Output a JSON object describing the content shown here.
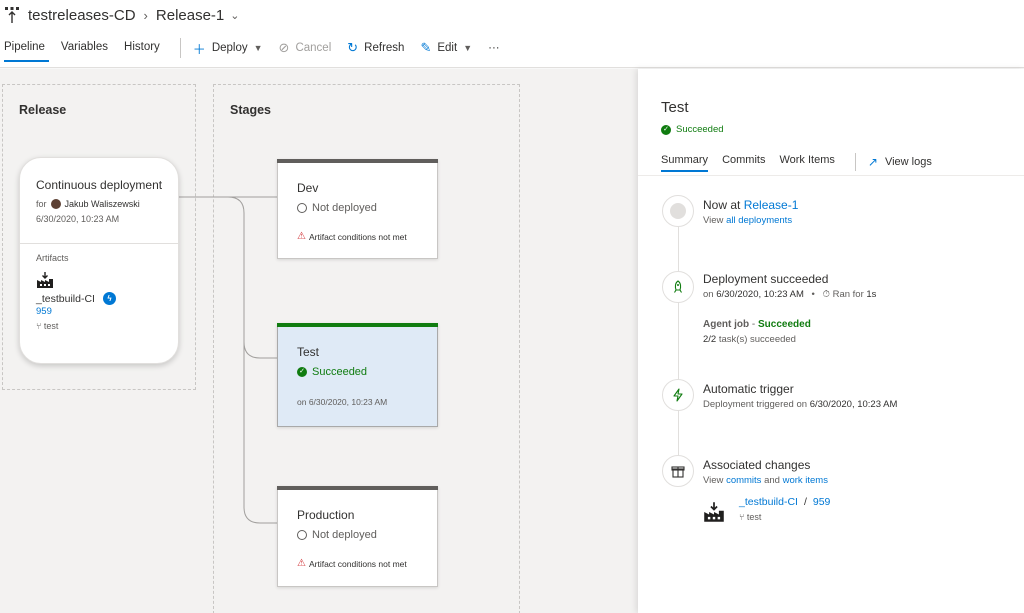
{
  "header": {
    "pipeline_name": "testreleases-CD",
    "release_name": "Release-1"
  },
  "toolbar": {
    "tabs": [
      {
        "label": "Pipeline",
        "active": true
      },
      {
        "label": "Variables",
        "active": false
      },
      {
        "label": "History",
        "active": false
      }
    ],
    "deploy_label": "Deploy",
    "cancel_label": "Cancel",
    "refresh_label": "Refresh",
    "edit_label": "Edit",
    "more_label": "···"
  },
  "canvas": {
    "release_group_title": "Release",
    "stages_group_title": "Stages",
    "trigger": {
      "title": "Continuous deployment",
      "for_label": "for",
      "user": "Jakub Waliszewski",
      "date": "6/30/2020, 10:23 AM"
    },
    "artifacts": {
      "label": "Artifacts",
      "name": "_testbuild-CI",
      "version": "959",
      "branch": "test"
    },
    "stages": [
      {
        "name": "Dev",
        "status": "Not deployed",
        "note": "Artifact conditions not met",
        "state": "pending"
      },
      {
        "name": "Test",
        "status": "Succeeded",
        "note": "on 6/30/2020, 10:23 AM",
        "state": "succeeded"
      },
      {
        "name": "Production",
        "status": "Not deployed",
        "note": "Artifact conditions not met",
        "state": "pending"
      }
    ]
  },
  "panel": {
    "title": "Test",
    "status": "Succeeded",
    "tabs": [
      {
        "label": "Summary",
        "active": true
      },
      {
        "label": "Commits",
        "active": false
      },
      {
        "label": "Work Items",
        "active": false
      }
    ],
    "view_logs_label": "View logs",
    "events": {
      "now_at": {
        "heading_prefix": "Now at",
        "release_link": "Release-1",
        "sub_prefix": "View",
        "sub_link": "all deployments"
      },
      "deployment": {
        "heading": "Deployment succeeded",
        "on_prefix": "on",
        "date": "6/30/2020, 10:23 AM",
        "ran_for_prefix": "Ran for",
        "duration": "1s",
        "agent_job": "Agent job",
        "agent_status": "Succeeded",
        "tasks": "2/2",
        "tasks_suffix": "task(s) succeeded"
      },
      "trigger": {
        "heading": "Automatic trigger",
        "sub_prefix": "Deployment triggered on",
        "date": "6/30/2020, 10:23 AM"
      },
      "changes": {
        "heading": "Associated changes",
        "view_label": "View",
        "commits_link": "commits",
        "and_label": "and",
        "work_items_link": "work items",
        "artifact_name": "_testbuild-CI",
        "artifact_version": "959",
        "artifact_branch": "test"
      }
    }
  },
  "colors": {
    "accent": "#0078d4",
    "success": "#107c10",
    "warning": "#d13438"
  }
}
